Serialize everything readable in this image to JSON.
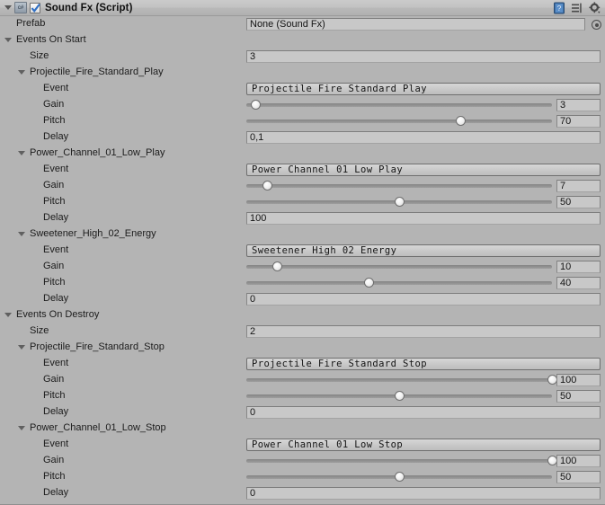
{
  "header": {
    "title": "Sound Fx (Script)",
    "script_icon_label": "c#",
    "enabled": true,
    "icons": [
      {
        "name": "help-icon",
        "label": "?"
      },
      {
        "name": "preset-icon",
        "label": ""
      },
      {
        "name": "gear-icon",
        "label": ""
      }
    ]
  },
  "prefab": {
    "label": "Prefab",
    "value": "None (Sound Fx)",
    "picker_name": "object-picker"
  },
  "sections": [
    {
      "label": "Events On Start",
      "size_label": "Size",
      "size_value": "3",
      "events": [
        {
          "name": "Projectile_Fire_Standard_Play",
          "event_label": "Event",
          "event_value": "Projectile Fire Standard Play",
          "gain_label": "Gain",
          "gain_value": "3",
          "pitch_label": "Pitch",
          "pitch_value": "70",
          "delay_label": "Delay",
          "delay_value": "0,1"
        },
        {
          "name": "Power_Channel_01_Low_Play",
          "event_label": "Event",
          "event_value": "Power Channel 01 Low Play",
          "gain_label": "Gain",
          "gain_value": "7",
          "pitch_label": "Pitch",
          "pitch_value": "50",
          "delay_label": "Delay",
          "delay_value": "100"
        },
        {
          "name": "Sweetener_High_02_Energy",
          "event_label": "Event",
          "event_value": "Sweetener High 02 Energy",
          "gain_label": "Gain",
          "gain_value": "10",
          "pitch_label": "Pitch",
          "pitch_value": "40",
          "delay_label": "Delay",
          "delay_value": "0"
        }
      ]
    },
    {
      "label": "Events On Destroy",
      "size_label": "Size",
      "size_value": "2",
      "events": [
        {
          "name": "Projectile_Fire_Standard_Stop",
          "event_label": "Event",
          "event_value": "Projectile Fire Standard Stop",
          "gain_label": "Gain",
          "gain_value": "100",
          "pitch_label": "Pitch",
          "pitch_value": "50",
          "delay_label": "Delay",
          "delay_value": "0"
        },
        {
          "name": "Power_Channel_01_Low_Stop",
          "event_label": "Event",
          "event_value": "Power Channel 01 Low Stop",
          "gain_label": "Gain",
          "gain_value": "100",
          "pitch_label": "Pitch",
          "pitch_value": "50",
          "delay_label": "Delay",
          "delay_value": "0"
        }
      ]
    }
  ],
  "slider_range": {
    "min": 0,
    "max": 100
  },
  "colors": {
    "background": "#b4b4b4",
    "field": "#c8c8c8",
    "accent": "#2f6fc4",
    "track": "#8f8f8f"
  }
}
